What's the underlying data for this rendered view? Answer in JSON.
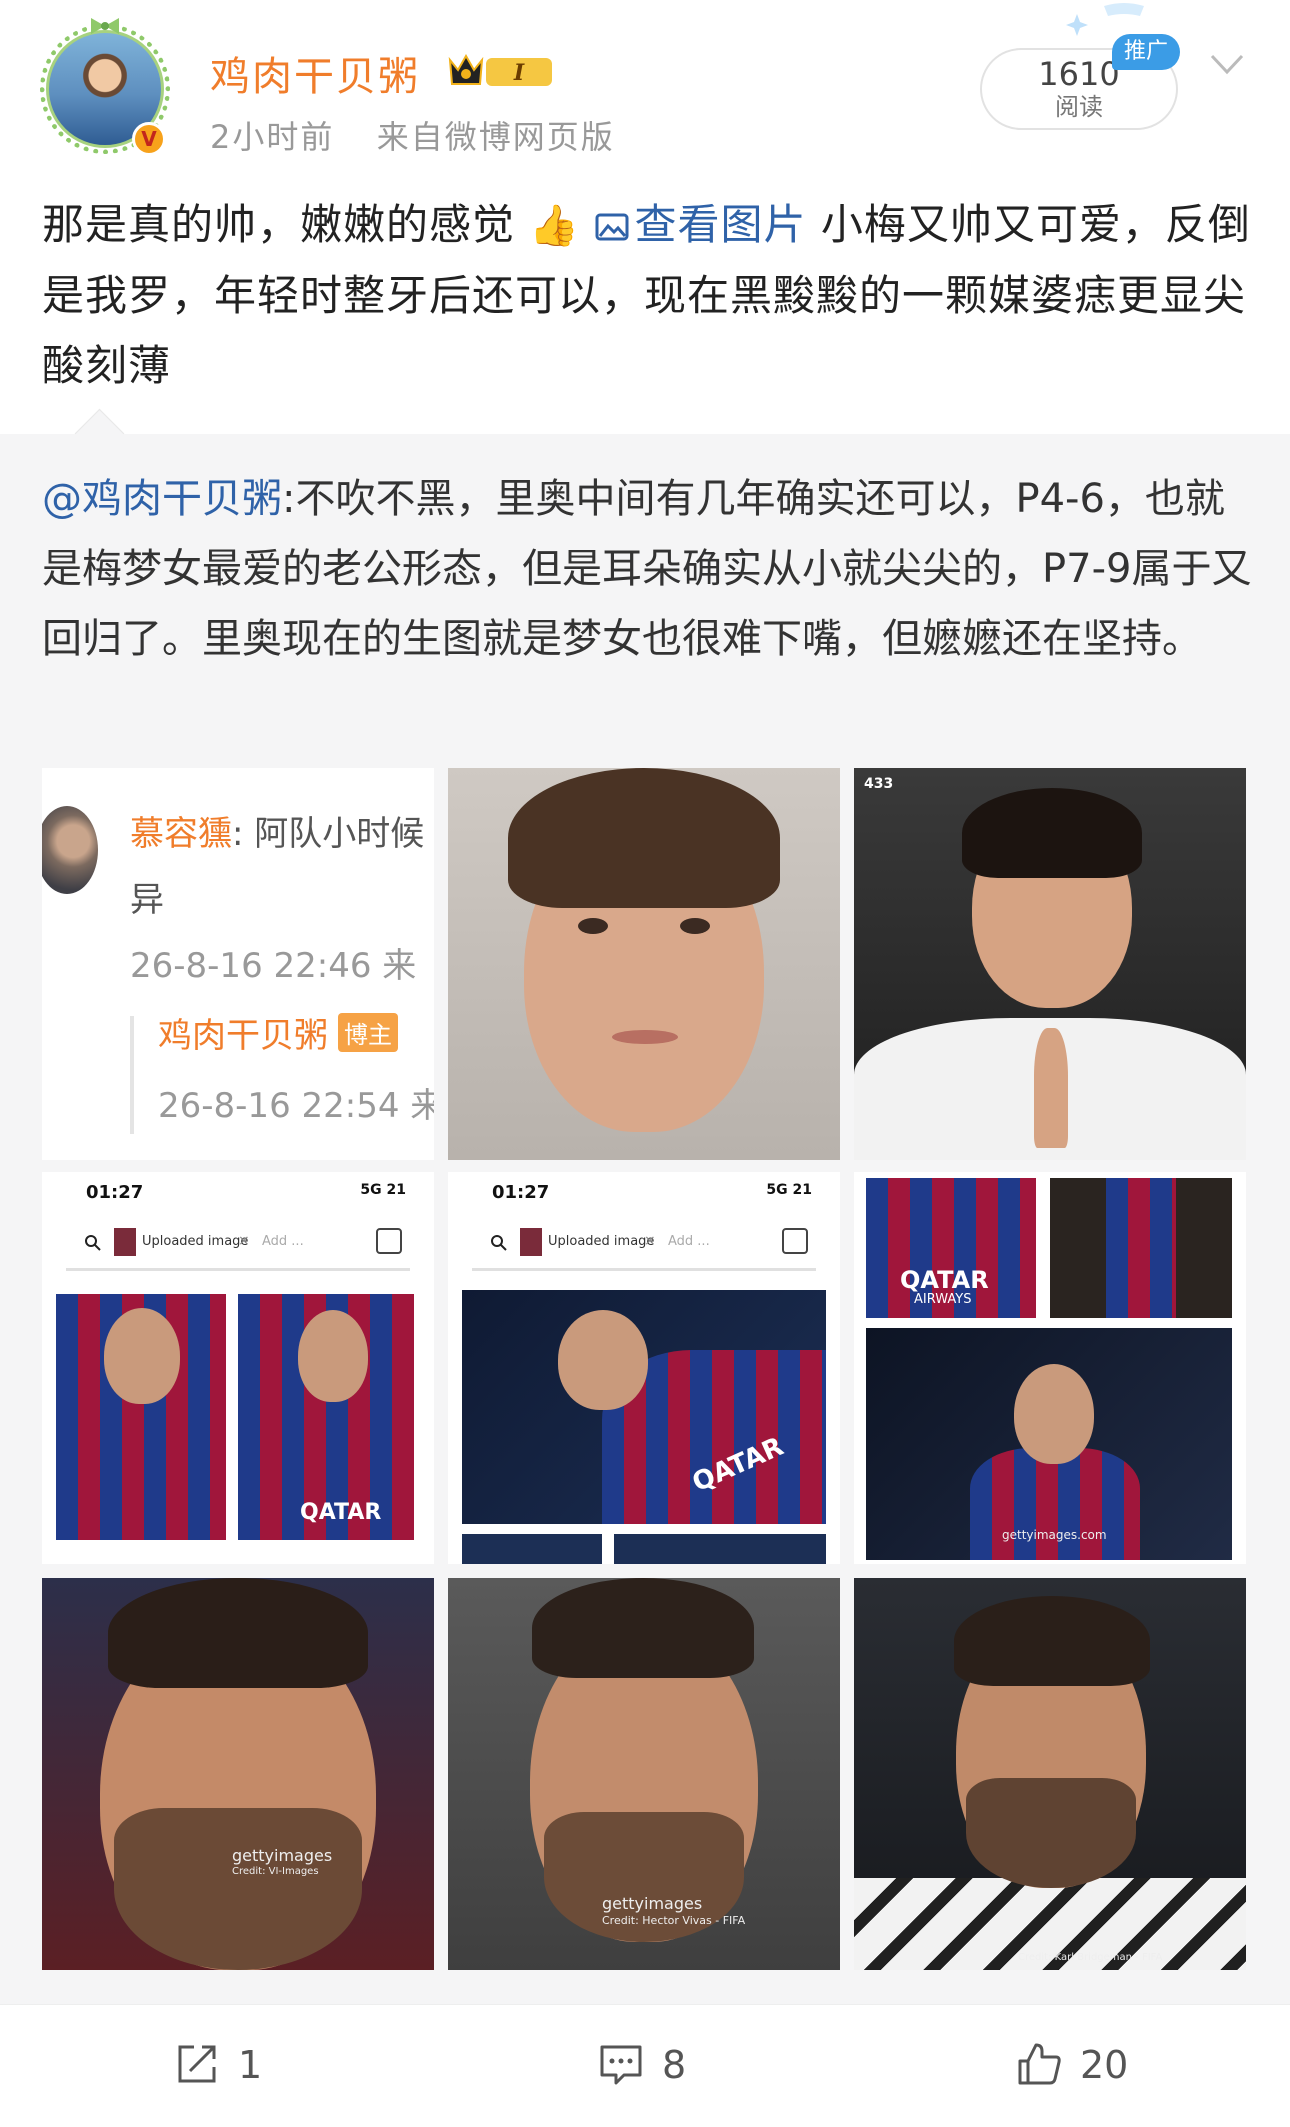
{
  "post": {
    "username": "鸡肉干贝粥",
    "level_badge": "I",
    "verified_mark": "V",
    "time": "2小时前",
    "source": "来自微博网页版",
    "read_count": "1610",
    "read_label": "阅读",
    "promo_label": "推广",
    "text_part1": "那是真的帅，嫩嫩的感觉",
    "thumb_emoji": "👍",
    "view_image_label": "查看图片",
    "text_part2": "小梅又帅又可爱，反倒是我罗，年轻时整牙后还可以，现在黑黢黢的一颗媒婆痣更显尖酸刻薄"
  },
  "repost": {
    "mention": "@鸡肉干贝粥",
    "text": ":不吹不黑，里奥中间有几年确实还可以，P4-6，也就是梅梦女最爱的老公形态，但是耳朵确实从小就尖尖的，P7-9属于又回归了。里奥现在的生图就是梦女也很难下嘴，但嬷嬷还在坚持。"
  },
  "images": {
    "comment_shot": {
      "commenter": "慕容獯",
      "comment_text": ": 阿队小时候",
      "comment_cont": "异",
      "comment_time": "26-8-16 22:46 来",
      "reply_name": "鸡肉干贝粥",
      "reply_badge": "博主",
      "reply_time": "26-8-16 22:54 来"
    },
    "photo3_tag": "433",
    "shot_a": {
      "time": "01:27",
      "signal": "5G",
      "battery": "21",
      "search_label": "Uploaded image",
      "search_close": "×",
      "search_add": "Add ..."
    },
    "shot_b": {
      "time": "01:27",
      "signal": "5G",
      "battery": "21",
      "search_label": "Uploaded image",
      "search_close": "×",
      "search_add": "Add ..."
    },
    "jersey_sponsor": "QATAR",
    "jersey_sponsor_sub": "AIRWAYS",
    "watermark_getty": "gettyimages.com",
    "photo7_credit_brand": "gettyimages",
    "photo7_credit": "Credit: VI-Images",
    "photo8_credit_brand": "gettyimages",
    "photo8_credit": "Credit: Hector Vivas - FIFA",
    "photo9_credit": "Credit: Karl Bridgeman - FIFA"
  },
  "footer": {
    "repost_count": "1",
    "comment_count": "8",
    "like_count": "20"
  },
  "colors": {
    "username": "#f07d2b",
    "link": "#2f62a8",
    "meta": "#999999",
    "repost_bg": "#f5f5f6"
  }
}
